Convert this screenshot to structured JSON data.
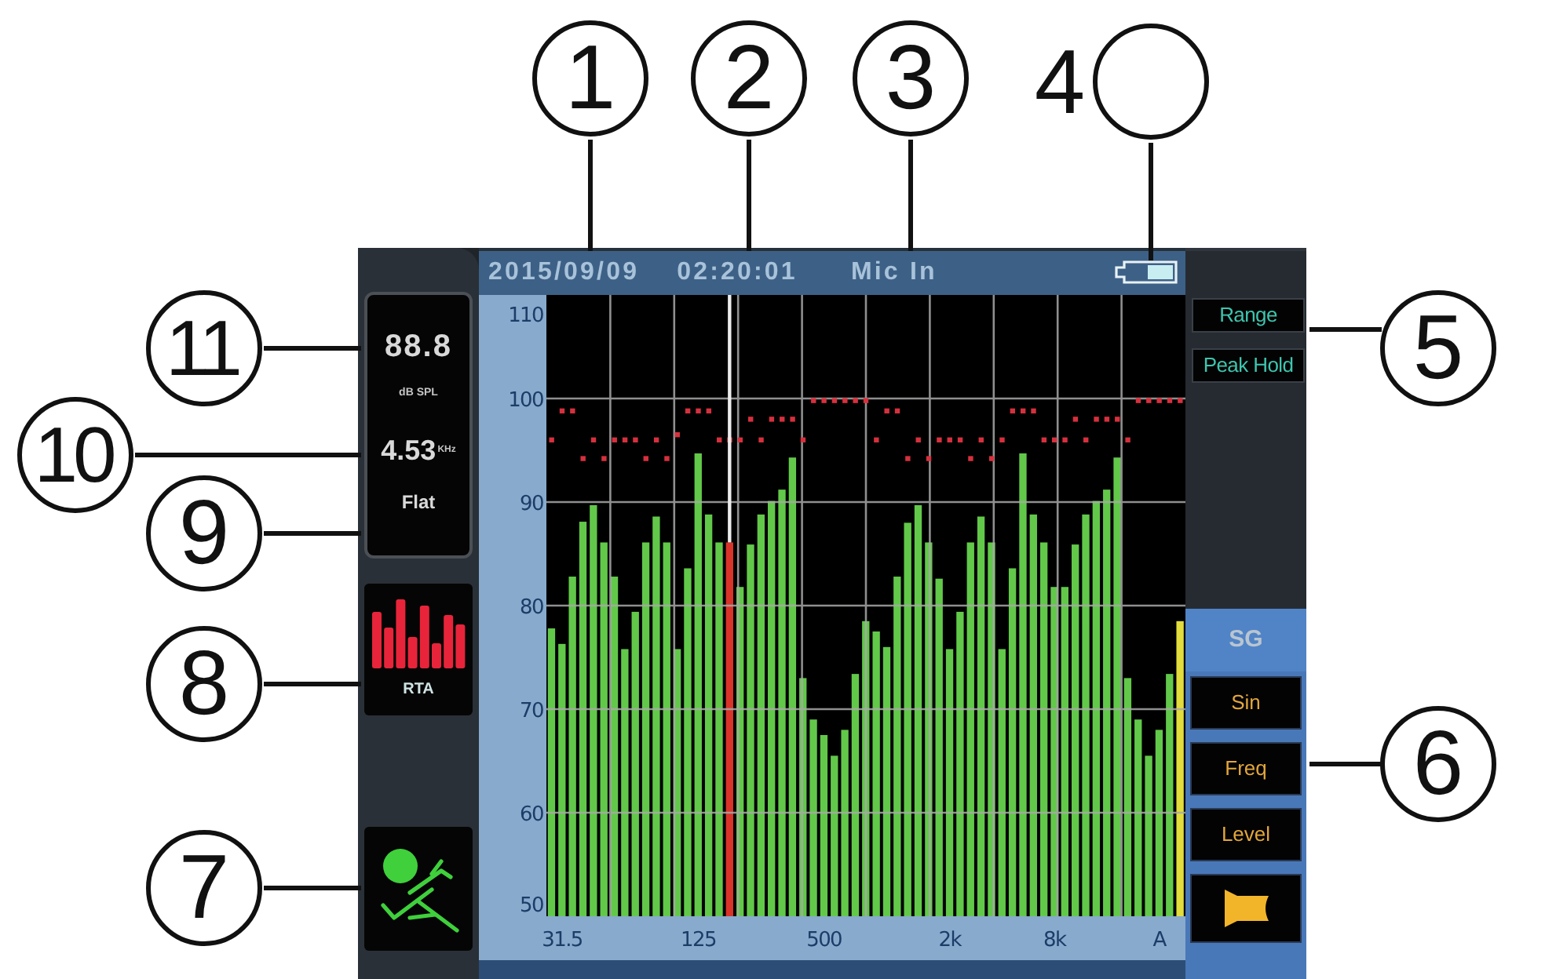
{
  "callouts": [
    {
      "label": "1"
    },
    {
      "label": "2"
    },
    {
      "label": "3"
    },
    {
      "label": "4"
    },
    {
      "label": "11"
    },
    {
      "label": "5"
    },
    {
      "label": "10"
    },
    {
      "label": "9"
    },
    {
      "label": "8"
    },
    {
      "label": "6"
    },
    {
      "label": "7"
    }
  ],
  "device": {
    "status_bar": {
      "date": "2015/09/09",
      "time": "02:20:01",
      "input": "Mic In"
    },
    "readout": {
      "spl": "88.8",
      "spl_unit": "dB SPL",
      "frequency": "4.53",
      "frequency_unit": "KHz",
      "weighting": "Flat"
    },
    "mode": {
      "label": "RTA"
    },
    "chart_data": {
      "type": "bar",
      "stacked": true,
      "grid": true,
      "ylim": [
        50,
        110
      ],
      "yticks": [
        50,
        60,
        70,
        80,
        90,
        100,
        110
      ],
      "categories": [
        null,
        "31.5",
        null,
        null,
        null,
        null,
        null,
        null,
        null,
        null,
        null,
        null,
        null,
        null,
        "125",
        null,
        null,
        null,
        null,
        null,
        null,
        null,
        null,
        null,
        null,
        null,
        "500",
        null,
        null,
        null,
        null,
        null,
        null,
        null,
        null,
        null,
        null,
        null,
        "2k",
        null,
        null,
        null,
        null,
        null,
        null,
        null,
        null,
        null,
        "8k",
        null,
        null,
        null,
        null,
        null,
        null,
        null,
        null,
        null,
        "A",
        null,
        null
      ],
      "series": [
        {
          "color": "#62c84a",
          "values": [
            77.8,
            76.3,
            82.8,
            88.1,
            89.7,
            86.1,
            82.8,
            75.8,
            79.4,
            86.1,
            88.6,
            86.1,
            75.8,
            83.6,
            94.7,
            88.8,
            86.1,
            null,
            81.8,
            85.9,
            88.8,
            90.1,
            91.2,
            94.3,
            73,
            69,
            67.5,
            65.5,
            68,
            73.4,
            78.5,
            77.5,
            76,
            82.8,
            88,
            89.7,
            86.1,
            82.6,
            75.8,
            79.4,
            86.1,
            88.6,
            86.1,
            75.8,
            83.6,
            94.7,
            88.8,
            86.1,
            81.8,
            81.8,
            85.9,
            88.8,
            90.1,
            91.2,
            94.3,
            73,
            69,
            65.5,
            68,
            73.4,
            null
          ]
        },
        {
          "color": "#d8342a",
          "values": [
            null,
            null,
            null,
            null,
            null,
            null,
            null,
            null,
            null,
            null,
            null,
            null,
            null,
            null,
            null,
            null,
            null,
            86.1,
            null,
            null,
            null,
            null,
            null,
            null,
            null,
            null,
            null,
            null,
            null,
            null,
            null,
            null,
            null,
            null,
            null,
            null,
            null,
            null,
            null,
            null,
            null,
            null,
            null,
            null,
            null,
            null,
            null,
            null,
            null,
            null,
            null,
            null,
            null,
            null,
            null,
            null,
            null,
            null,
            null,
            null,
            null
          ]
        },
        {
          "color": "#e2dc3c",
          "values": [
            null,
            null,
            null,
            null,
            null,
            null,
            null,
            null,
            null,
            null,
            null,
            null,
            null,
            null,
            null,
            null,
            null,
            null,
            null,
            null,
            null,
            null,
            null,
            null,
            null,
            null,
            null,
            null,
            null,
            null,
            null,
            null,
            null,
            null,
            null,
            null,
            null,
            null,
            null,
            null,
            null,
            null,
            null,
            null,
            null,
            null,
            null,
            null,
            null,
            null,
            null,
            null,
            null,
            null,
            null,
            null,
            null,
            null,
            null,
            null,
            78.5
          ]
        },
        {
          "type": "scatter",
          "color": "#d6303e",
          "values": [
            96,
            98.8,
            98.8,
            94.2,
            96,
            94.2,
            96,
            96,
            96,
            94.2,
            96,
            94.2,
            96.5,
            98.8,
            98.8,
            98.8,
            96,
            96,
            96,
            98,
            96,
            98,
            98,
            98,
            96,
            99.8,
            99.8,
            99.8,
            99.8,
            99.8,
            99.8,
            96,
            98.8,
            98.8,
            94.2,
            96,
            94.2,
            96,
            96,
            96,
            94.2,
            96,
            94.2,
            96,
            98.8,
            98.8,
            98.8,
            96,
            96,
            96,
            98,
            96,
            98,
            98,
            98,
            96,
            99.8,
            99.8,
            99.8,
            99.8,
            99.8
          ]
        }
      ]
    },
    "right_panel": {
      "buttons": [
        {
          "label": "Range"
        },
        {
          "label": "Peak Hold"
        }
      ],
      "sg_title": "SG",
      "sg_buttons": [
        {
          "kind": "text",
          "label": "Sin"
        },
        {
          "kind": "text",
          "label": "Freq"
        },
        {
          "kind": "text",
          "label": "Level"
        },
        {
          "kind": "icon"
        }
      ]
    }
  }
}
